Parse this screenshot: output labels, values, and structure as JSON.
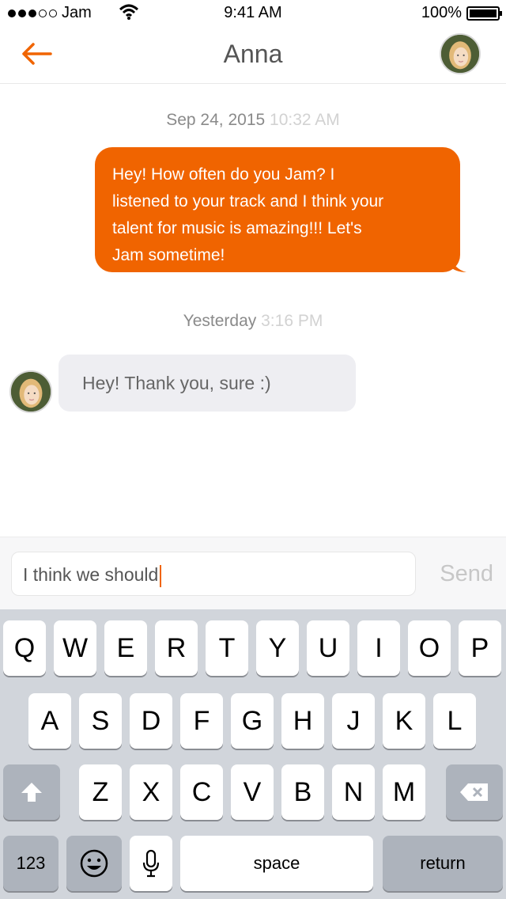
{
  "status_bar": {
    "carrier": "Jam",
    "time": "9:41 AM",
    "battery": "100%",
    "signal_icon": "signal-dots-icon",
    "wifi_icon": "wifi-icon",
    "battery_icon": "battery-icon"
  },
  "nav": {
    "title": "Anna",
    "back_icon": "arrow-left-icon",
    "accent_color": "#f06400"
  },
  "messages": [
    {
      "timestamp_date": "Sep 24, 2015",
      "timestamp_time": "10:32 AM",
      "direction": "outgoing",
      "lines": [
        "Hey! How often do you Jam? I",
        "listened to your track and I think your",
        "talent for music is amazing!!! Let's",
        "Jam sometime!"
      ]
    },
    {
      "timestamp_date": "Yesterday",
      "timestamp_time": "3:16 PM",
      "direction": "incoming",
      "text": "Hey! Thank you, sure :)"
    }
  ],
  "composer": {
    "value": "I think we should",
    "send_label": "Send"
  },
  "keyboard": {
    "row1": [
      "Q",
      "W",
      "E",
      "R",
      "T",
      "Y",
      "U",
      "I",
      "O",
      "P"
    ],
    "row2": [
      "A",
      "S",
      "D",
      "F",
      "G",
      "H",
      "J",
      "K",
      "L"
    ],
    "row3": [
      "Z",
      "X",
      "C",
      "V",
      "B",
      "N",
      "M"
    ],
    "numbers_label": "123",
    "space_label": "space",
    "return_label": "return",
    "shift_icon": "shift-arrow-icon",
    "delete_icon": "backspace-icon",
    "emoji_icon": "emoji-icon",
    "mic_icon": "microphone-icon"
  }
}
